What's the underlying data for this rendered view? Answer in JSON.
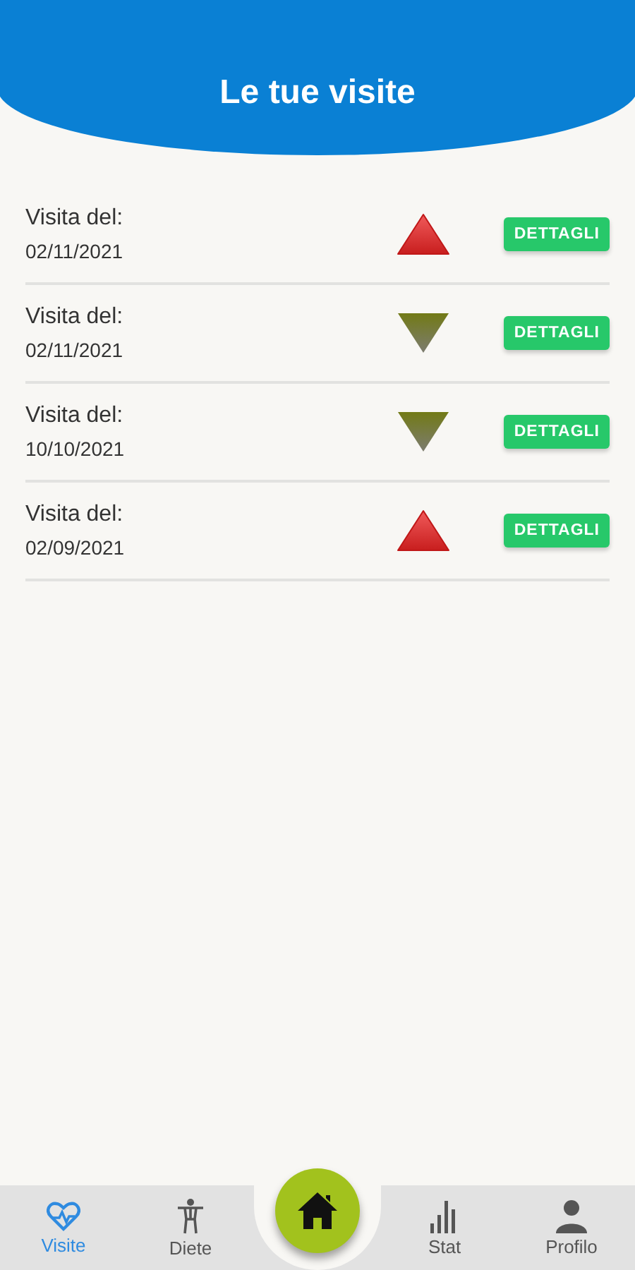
{
  "header": {
    "title": "Le tue visite"
  },
  "visits": [
    {
      "label": "Visita del:",
      "date": "02/11/2021",
      "kind": "up",
      "button": "DETTAGLI"
    },
    {
      "label": "Visita del:",
      "date": "02/11/2021",
      "kind": "down",
      "button": "DETTAGLI"
    },
    {
      "label": "Visita del:",
      "date": "10/10/2021",
      "kind": "down",
      "button": "DETTAGLI"
    },
    {
      "label": "Visita del:",
      "date": "02/09/2021",
      "kind": "up",
      "button": "DETTAGLI"
    }
  ],
  "nav": [
    {
      "kind": "heart",
      "label": "Visite",
      "selected": true
    },
    {
      "kind": "body",
      "label": "Diete",
      "selected": false
    },
    {
      "kind": "home",
      "selected": false
    },
    {
      "kind": "chart",
      "label": "Stat",
      "selected": false
    },
    {
      "kind": "person",
      "label": "Profilo",
      "selected": false
    }
  ]
}
